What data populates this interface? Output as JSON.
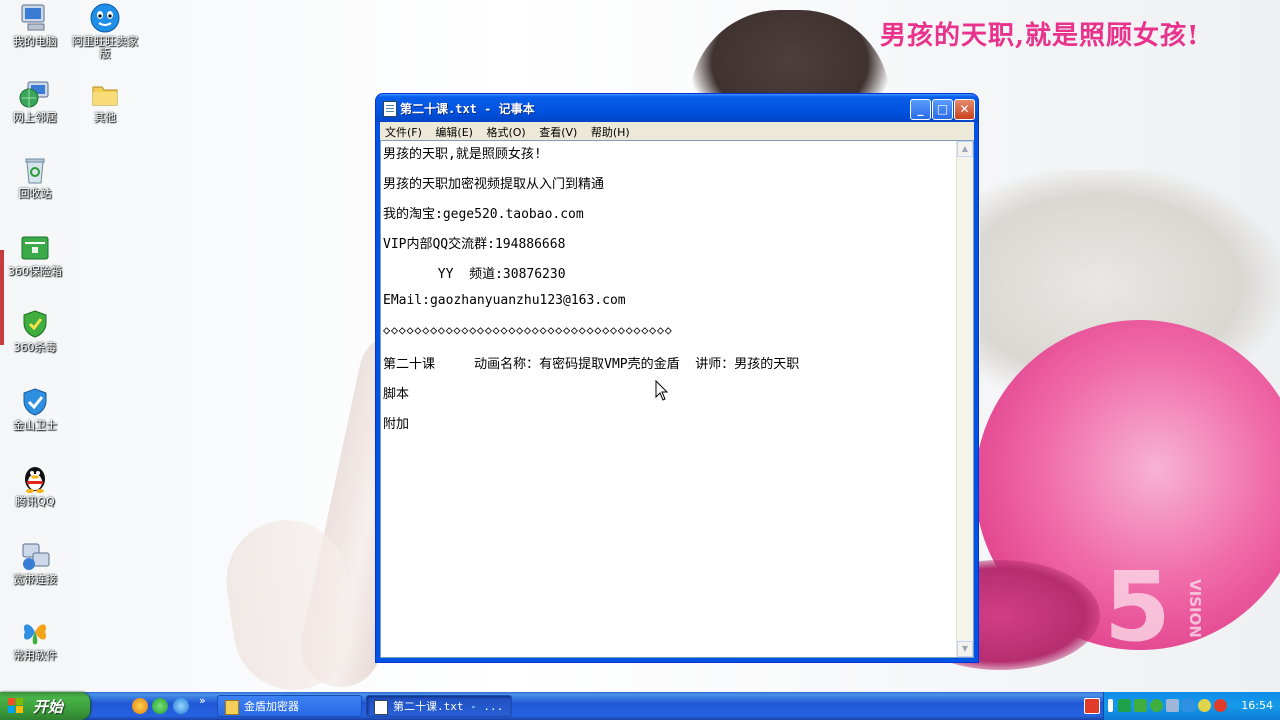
{
  "desktop": {
    "slogan": "男孩的天职,就是照顾女孩!",
    "watermark_number": "5",
    "watermark_text": "VISION",
    "icons": [
      {
        "label": "我的电脑"
      },
      {
        "label": "阿里旺旺卖家版"
      },
      {
        "label": "网上邻居"
      },
      {
        "label": "其他"
      },
      {
        "label": "回收站"
      },
      {
        "label": "360保险箱"
      },
      {
        "label": "360杀毒"
      },
      {
        "label": "金山卫士"
      },
      {
        "label": "腾讯QQ"
      },
      {
        "label": "宽带连接"
      },
      {
        "label": "常用软件"
      }
    ]
  },
  "notepad": {
    "title": "第二十课.txt - 记事本",
    "menu": [
      "文件(F)",
      "编辑(E)",
      "格式(O)",
      "查看(V)",
      "帮助(H)"
    ],
    "lines": [
      "男孩的天职,就是照顾女孩!",
      "男孩的天职加密视频提取从入门到精通",
      "我的淘宝:gege520.taobao.com",
      "VIP内部QQ交流群:194886668",
      "       YY  频道:30876230",
      "EMail:gaozhanyuanzhu123@163.com",
      "◇◇◇◇◇◇◇◇◇◇◇◇◇◇◇◇◇◇◇◇◇◇◇◇◇◇◇◇◇◇◇◇◇◇◇◇◇",
      "第二十课     动画名称：有密码提取VMP壳的金盾  讲师：男孩的天职",
      "脚本",
      "附加"
    ]
  },
  "taskbar": {
    "start_label": "开始",
    "tasks": [
      {
        "label": "金盾加密器"
      },
      {
        "label": "第二十课.txt - ..."
      }
    ],
    "clock": "16:54"
  },
  "colors": {
    "slogan": "#e8328c",
    "xp_blue": "#0054e3",
    "taskbar": "#2457d6",
    "start_green": "#3a9a3a"
  }
}
